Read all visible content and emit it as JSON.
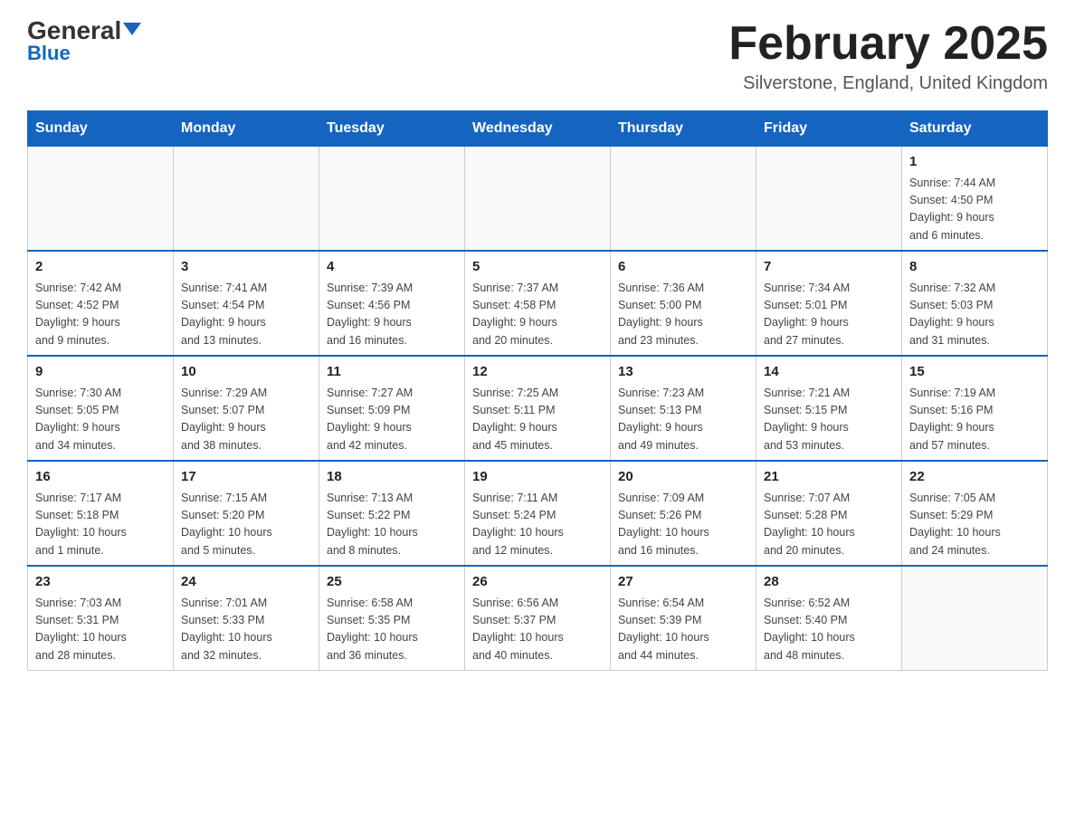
{
  "header": {
    "logo_general": "General",
    "logo_blue": "Blue",
    "month_title": "February 2025",
    "location": "Silverstone, England, United Kingdom"
  },
  "weekdays": [
    "Sunday",
    "Monday",
    "Tuesday",
    "Wednesday",
    "Thursday",
    "Friday",
    "Saturday"
  ],
  "weeks": [
    [
      {
        "day": "",
        "info": ""
      },
      {
        "day": "",
        "info": ""
      },
      {
        "day": "",
        "info": ""
      },
      {
        "day": "",
        "info": ""
      },
      {
        "day": "",
        "info": ""
      },
      {
        "day": "",
        "info": ""
      },
      {
        "day": "1",
        "info": "Sunrise: 7:44 AM\nSunset: 4:50 PM\nDaylight: 9 hours\nand 6 minutes."
      }
    ],
    [
      {
        "day": "2",
        "info": "Sunrise: 7:42 AM\nSunset: 4:52 PM\nDaylight: 9 hours\nand 9 minutes."
      },
      {
        "day": "3",
        "info": "Sunrise: 7:41 AM\nSunset: 4:54 PM\nDaylight: 9 hours\nand 13 minutes."
      },
      {
        "day": "4",
        "info": "Sunrise: 7:39 AM\nSunset: 4:56 PM\nDaylight: 9 hours\nand 16 minutes."
      },
      {
        "day": "5",
        "info": "Sunrise: 7:37 AM\nSunset: 4:58 PM\nDaylight: 9 hours\nand 20 minutes."
      },
      {
        "day": "6",
        "info": "Sunrise: 7:36 AM\nSunset: 5:00 PM\nDaylight: 9 hours\nand 23 minutes."
      },
      {
        "day": "7",
        "info": "Sunrise: 7:34 AM\nSunset: 5:01 PM\nDaylight: 9 hours\nand 27 minutes."
      },
      {
        "day": "8",
        "info": "Sunrise: 7:32 AM\nSunset: 5:03 PM\nDaylight: 9 hours\nand 31 minutes."
      }
    ],
    [
      {
        "day": "9",
        "info": "Sunrise: 7:30 AM\nSunset: 5:05 PM\nDaylight: 9 hours\nand 34 minutes."
      },
      {
        "day": "10",
        "info": "Sunrise: 7:29 AM\nSunset: 5:07 PM\nDaylight: 9 hours\nand 38 minutes."
      },
      {
        "day": "11",
        "info": "Sunrise: 7:27 AM\nSunset: 5:09 PM\nDaylight: 9 hours\nand 42 minutes."
      },
      {
        "day": "12",
        "info": "Sunrise: 7:25 AM\nSunset: 5:11 PM\nDaylight: 9 hours\nand 45 minutes."
      },
      {
        "day": "13",
        "info": "Sunrise: 7:23 AM\nSunset: 5:13 PM\nDaylight: 9 hours\nand 49 minutes."
      },
      {
        "day": "14",
        "info": "Sunrise: 7:21 AM\nSunset: 5:15 PM\nDaylight: 9 hours\nand 53 minutes."
      },
      {
        "day": "15",
        "info": "Sunrise: 7:19 AM\nSunset: 5:16 PM\nDaylight: 9 hours\nand 57 minutes."
      }
    ],
    [
      {
        "day": "16",
        "info": "Sunrise: 7:17 AM\nSunset: 5:18 PM\nDaylight: 10 hours\nand 1 minute."
      },
      {
        "day": "17",
        "info": "Sunrise: 7:15 AM\nSunset: 5:20 PM\nDaylight: 10 hours\nand 5 minutes."
      },
      {
        "day": "18",
        "info": "Sunrise: 7:13 AM\nSunset: 5:22 PM\nDaylight: 10 hours\nand 8 minutes."
      },
      {
        "day": "19",
        "info": "Sunrise: 7:11 AM\nSunset: 5:24 PM\nDaylight: 10 hours\nand 12 minutes."
      },
      {
        "day": "20",
        "info": "Sunrise: 7:09 AM\nSunset: 5:26 PM\nDaylight: 10 hours\nand 16 minutes."
      },
      {
        "day": "21",
        "info": "Sunrise: 7:07 AM\nSunset: 5:28 PM\nDaylight: 10 hours\nand 20 minutes."
      },
      {
        "day": "22",
        "info": "Sunrise: 7:05 AM\nSunset: 5:29 PM\nDaylight: 10 hours\nand 24 minutes."
      }
    ],
    [
      {
        "day": "23",
        "info": "Sunrise: 7:03 AM\nSunset: 5:31 PM\nDaylight: 10 hours\nand 28 minutes."
      },
      {
        "day": "24",
        "info": "Sunrise: 7:01 AM\nSunset: 5:33 PM\nDaylight: 10 hours\nand 32 minutes."
      },
      {
        "day": "25",
        "info": "Sunrise: 6:58 AM\nSunset: 5:35 PM\nDaylight: 10 hours\nand 36 minutes."
      },
      {
        "day": "26",
        "info": "Sunrise: 6:56 AM\nSunset: 5:37 PM\nDaylight: 10 hours\nand 40 minutes."
      },
      {
        "day": "27",
        "info": "Sunrise: 6:54 AM\nSunset: 5:39 PM\nDaylight: 10 hours\nand 44 minutes."
      },
      {
        "day": "28",
        "info": "Sunrise: 6:52 AM\nSunset: 5:40 PM\nDaylight: 10 hours\nand 48 minutes."
      },
      {
        "day": "",
        "info": ""
      }
    ]
  ]
}
